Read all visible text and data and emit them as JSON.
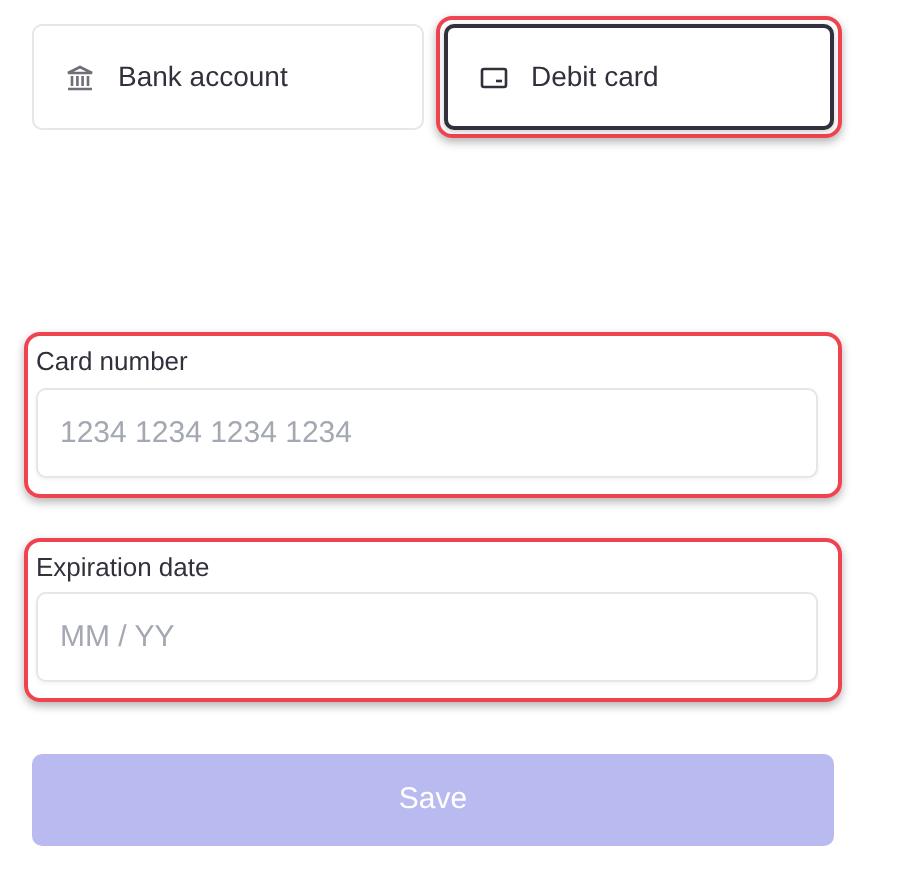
{
  "tabs": [
    {
      "label": "Bank account",
      "kind": "bank",
      "selected": false,
      "highlighted": false
    },
    {
      "label": "Debit card",
      "kind": "card",
      "selected": true,
      "highlighted": true
    }
  ],
  "fields": [
    {
      "label": "Card number",
      "placeholder": "1234 1234 1234 1234",
      "highlighted": true
    },
    {
      "label": "Expiration date",
      "placeholder": "MM / YY",
      "highlighted": true
    }
  ],
  "save_button": {
    "label": "Save",
    "disabled": true
  }
}
